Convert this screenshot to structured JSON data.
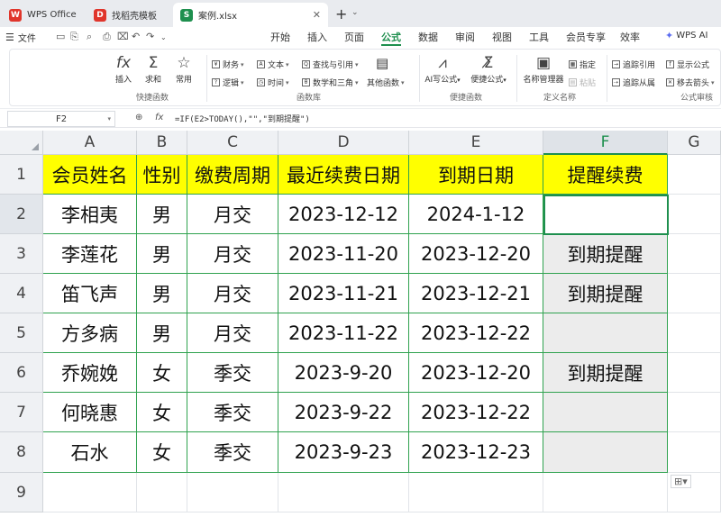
{
  "tabs": [
    {
      "label": "WPS Office",
      "icon": "wps-logo-icon"
    },
    {
      "label": "找稻壳模板",
      "icon": "template-icon"
    },
    {
      "label": "案例.xlsx",
      "icon": "spreadsheet-icon"
    }
  ],
  "menubar": {
    "file_label": "文件",
    "items": [
      "开始",
      "插入",
      "页面",
      "公式",
      "数据",
      "审阅",
      "视图",
      "工具",
      "会员专享",
      "效率"
    ],
    "active": "公式",
    "ai_label": "WPS AI"
  },
  "ribbon": {
    "insert_label": "插入",
    "sum_label": "求和",
    "common_label": "常用",
    "finance_label": "财务",
    "text_label": "文本",
    "lookup_label": "查找与引用",
    "logic_label": "逻辑",
    "time_label": "时间",
    "math_label": "数学和三角",
    "other_label": "其他函数",
    "ai_formula_label": "AI写公式",
    "quick_formula_label": "便捷公式",
    "name_manager_label": "名称管理器",
    "define_label": "指定",
    "paste_label": "粘贴",
    "trace_precedents_label": "追踪引用",
    "trace_dependents_label": "追踪从属",
    "show_formula_label": "显示公式",
    "remove_arrows_label": "移去箭头",
    "groups": {
      "quick_functions": "快捷函数",
      "function_library": "函数库",
      "quick_tools": "便捷函数",
      "defined_names": "定义名称",
      "audit": "公式审核"
    }
  },
  "formula_bar": {
    "cell_ref": "F2",
    "formula": "=IF(E2>TODAY(),\"\",\"到期提醒\")"
  },
  "sheet": {
    "columns": [
      "A",
      "B",
      "C",
      "D",
      "E",
      "F",
      "G"
    ],
    "selected_column": "F",
    "rows": [
      "1",
      "2",
      "3",
      "4",
      "5",
      "6",
      "7",
      "8",
      "9"
    ],
    "selected_cell": "F2",
    "headers": [
      "会员姓名",
      "性别",
      "缴费周期",
      "最近续费日期",
      "到期日期",
      "提醒续费"
    ],
    "data": [
      [
        "李相夷",
        "男",
        "月交",
        "2023-12-12",
        "2024-1-12",
        ""
      ],
      [
        "李莲花",
        "男",
        "月交",
        "2023-11-20",
        "2023-12-20",
        "到期提醒"
      ],
      [
        "笛飞声",
        "男",
        "月交",
        "2023-11-21",
        "2023-12-21",
        "到期提醒"
      ],
      [
        "方多病",
        "男",
        "月交",
        "2023-11-22",
        "2023-12-22",
        ""
      ],
      [
        "乔婉娩",
        "女",
        "季交",
        "2023-9-20",
        "2023-12-20",
        "到期提醒"
      ],
      [
        "何晓惠",
        "女",
        "季交",
        "2023-9-22",
        "2023-12-22",
        ""
      ],
      [
        "石水",
        "女",
        "季交",
        "2023-9-23",
        "2023-12-23",
        ""
      ]
    ]
  },
  "colors": {
    "accent": "#1e8f4e",
    "header_fill": "#ffff00",
    "table_border": "#2fa24f"
  }
}
